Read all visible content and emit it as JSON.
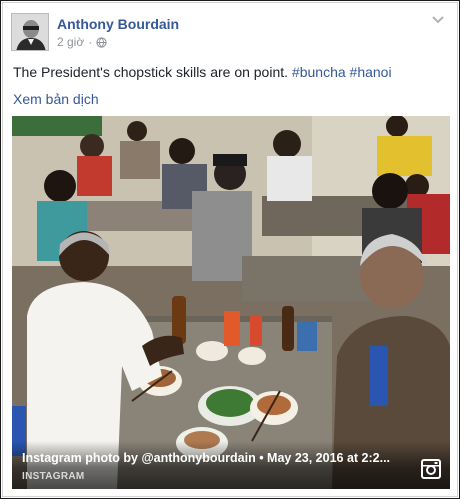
{
  "post": {
    "author": "Anthony Bourdain",
    "timestamp": "2 giờ",
    "separator": "·",
    "text_main": "The President's chopstick skills are on point.",
    "hashtags": [
      "#buncha",
      "#hanoi"
    ],
    "translate_link": "Xem bản dịch"
  },
  "photo": {
    "caption": "Instagram photo by @anthonybourdain • May 23, 2016 at 2:2...",
    "source_label": "INSTAGRAM"
  },
  "icons": {
    "privacy": "globe-icon",
    "options": "chevron-down-icon",
    "instagram": "instagram-icon"
  },
  "colors": {
    "link": "#365899",
    "text": "#1d2129",
    "meta": "#90949c"
  }
}
